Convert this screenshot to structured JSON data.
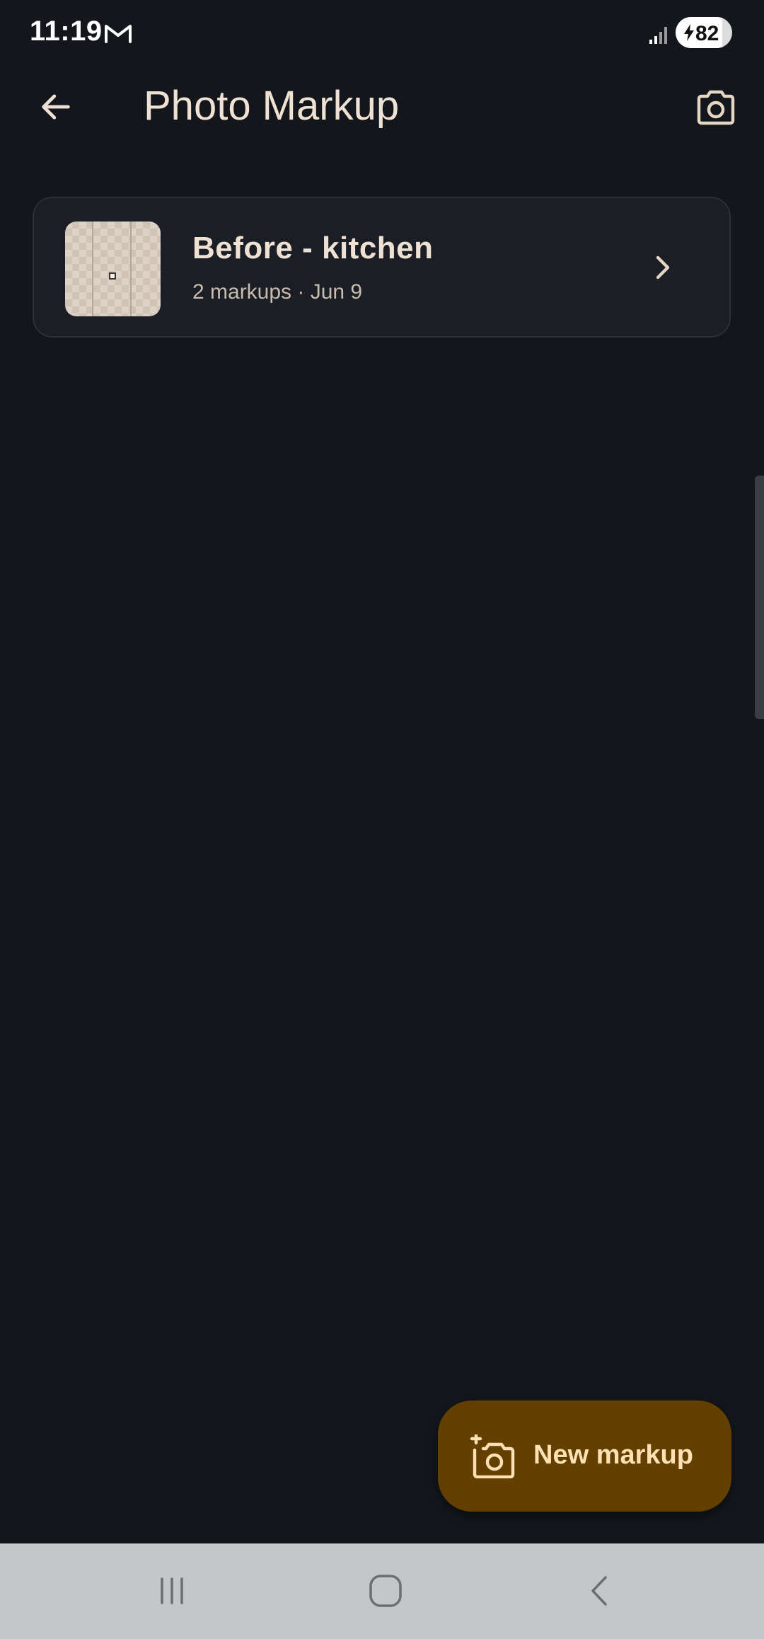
{
  "status_bar": {
    "time": "11:19",
    "notification_icon": "gmail-icon",
    "signal_icon": "signal-icon",
    "battery_percent": "82",
    "battery_level": 0.82,
    "charging": true
  },
  "app_bar": {
    "title": "Photo Markup",
    "back_icon": "arrow-back-icon",
    "action_icon": "camera-icon"
  },
  "markups": [
    {
      "title": "Before - kitchen",
      "subtitle": "2 markups · Jun 9",
      "thumbnail_icon": "photo-thumbnail",
      "trailing_icon": "chevron-right-icon"
    }
  ],
  "fab": {
    "label": "New markup",
    "icon": "add-camera-icon"
  },
  "nav_bar": {
    "recents_icon": "recents-icon",
    "home_icon": "home-icon",
    "back_icon": "back-icon"
  },
  "colors": {
    "background": "#13161b",
    "card": "#1b1e24",
    "text_primary": "#efe2d4",
    "text_secondary": "#c8bcae",
    "fab_background": "#633f00",
    "fab_text": "#fde0b3",
    "nav_bar": "#c5c6c8"
  }
}
